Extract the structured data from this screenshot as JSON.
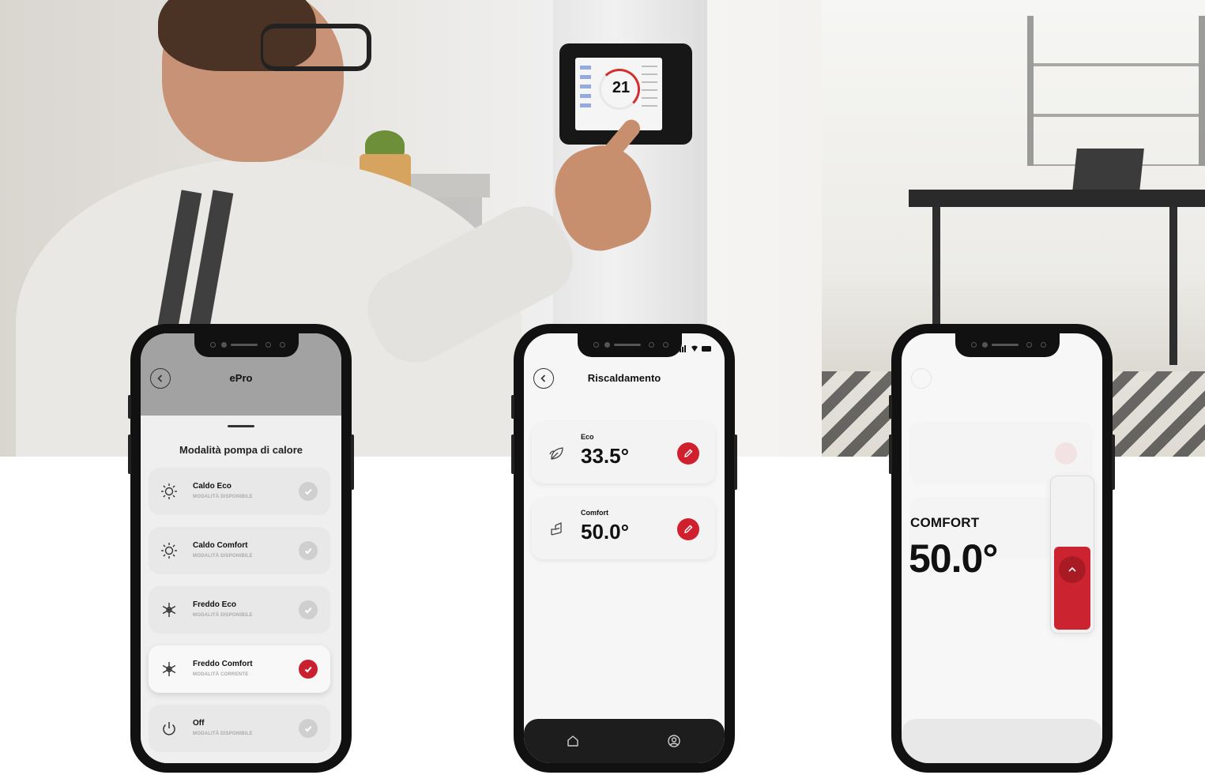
{
  "thermostat": {
    "temperature": "21"
  },
  "phone1": {
    "title": "ePro",
    "sheet_title": "Modalità pompa di calore",
    "modes": [
      {
        "name": "Caldo Eco",
        "status": "MODALITÀ DISPONIBILE",
        "icon": "sun-icon",
        "selected": false
      },
      {
        "name": "Caldo Comfort",
        "status": "MODALITÀ DISPONIBILE",
        "icon": "sun-icon",
        "selected": false
      },
      {
        "name": "Freddo Eco",
        "status": "MODALITÀ DISPONIBILE",
        "icon": "snowflake-icon",
        "selected": false
      },
      {
        "name": "Freddo Comfort",
        "status": "MODALITÀ CORRENTE",
        "icon": "snowflake-icon",
        "selected": true
      },
      {
        "name": "Off",
        "status": "MODALITÀ DISPONIBILE",
        "icon": "power-icon",
        "selected": false
      }
    ]
  },
  "phone2": {
    "title": "Riscaldamento",
    "setpoints": [
      {
        "label": "Eco",
        "value": "33.5°",
        "icon": "leaf-icon"
      },
      {
        "label": "Comfort",
        "value": "50.0°",
        "icon": "sofa-icon"
      }
    ],
    "tabs": [
      {
        "name": "home",
        "icon": "home-icon"
      },
      {
        "name": "profile",
        "icon": "user-icon"
      }
    ]
  },
  "phone3": {
    "label": "COMFORT",
    "value": "50.0°",
    "slider_level": 0.55
  },
  "colors": {
    "accent": "#d01f2d",
    "dark": "#111111"
  }
}
